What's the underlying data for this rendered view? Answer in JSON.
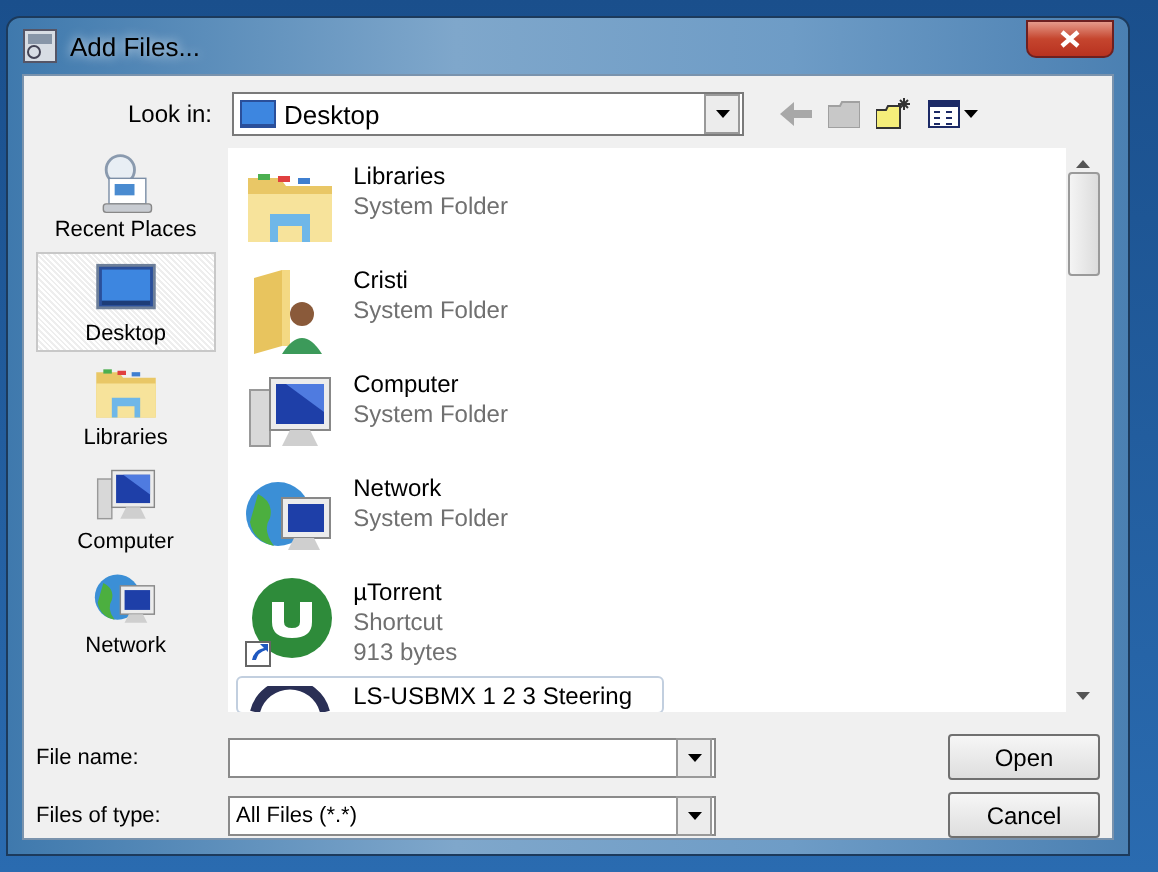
{
  "window": {
    "title": "Add Files..."
  },
  "look_in": {
    "label": "Look in:",
    "value": "Desktop"
  },
  "places": [
    {
      "label": "Recent Places",
      "kind": "recent",
      "selected": false
    },
    {
      "label": "Desktop",
      "kind": "desktop",
      "selected": true
    },
    {
      "label": "Libraries",
      "kind": "libraries",
      "selected": false
    },
    {
      "label": "Computer",
      "kind": "computer",
      "selected": false
    },
    {
      "label": "Network",
      "kind": "network",
      "selected": false
    }
  ],
  "files": [
    {
      "name": "Libraries",
      "details": [
        "System Folder"
      ],
      "kind": "libraries",
      "selected": false
    },
    {
      "name": "Cristi",
      "details": [
        "System Folder"
      ],
      "kind": "user",
      "selected": false
    },
    {
      "name": "Computer",
      "details": [
        "System Folder"
      ],
      "kind": "computer",
      "selected": false
    },
    {
      "name": "Network",
      "details": [
        "System Folder"
      ],
      "kind": "network",
      "selected": false
    },
    {
      "name": "µTorrent",
      "details": [
        "Shortcut",
        "913 bytes"
      ],
      "kind": "shortcut",
      "selected": false
    },
    {
      "name": "LS-USBMX 1 2 3 Steering",
      "kind": "wheel",
      "selected": true
    }
  ],
  "file_name": {
    "label": "File name:"
  },
  "file_type": {
    "label": "Files of type:",
    "value": "All Files (*.*)"
  },
  "buttons": [
    "Open",
    "Cancel"
  ]
}
